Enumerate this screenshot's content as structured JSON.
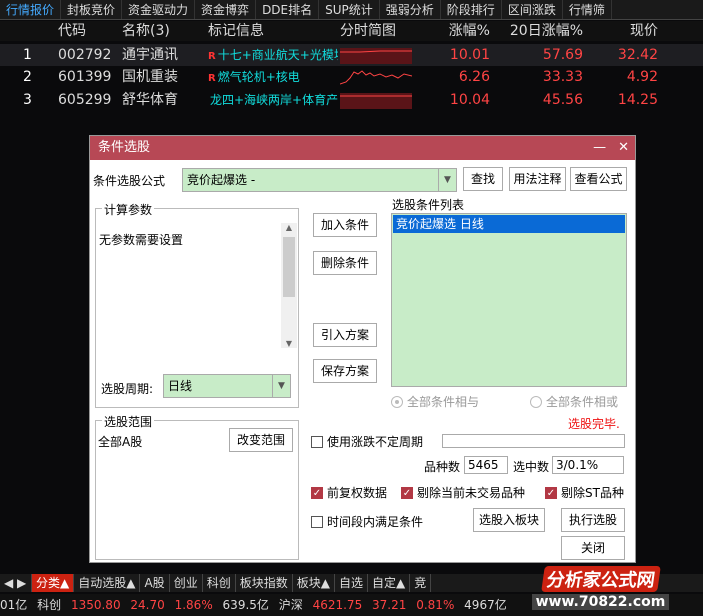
{
  "top_tabs": [
    "行情报价",
    "封板竞价",
    "资金驱动力",
    "资金博弈",
    "DDE排名",
    "SUP统计",
    "强弱分析",
    "阶段排行",
    "区间涨跌",
    "行情筛"
  ],
  "header": {
    "no": "",
    "code": "代码",
    "name": "名称(3)",
    "tag": "标记信息",
    "spark": "分时简图",
    "pct": "涨幅%",
    "pct20": "20日涨幅%",
    "price": "现价"
  },
  "rows": [
    {
      "no": "1",
      "code": "002792",
      "name": "通宇通讯",
      "tag_r": "R",
      "tag": "十七+商业航天+光模块",
      "pct": "10.01",
      "pct20": "57.69",
      "price": "32.42"
    },
    {
      "no": "2",
      "code": "601399",
      "name": "国机重装",
      "tag_r": "R",
      "tag": "燃气轮机+核电",
      "pct": "6.26",
      "pct20": "33.33",
      "price": "4.92"
    },
    {
      "no": "3",
      "code": "605299",
      "name": "舒华体育",
      "tag_r": "",
      "tag": "龙四+海峡两岸+体育产",
      "pct": "10.04",
      "pct20": "45.56",
      "price": "14.25"
    }
  ],
  "dialog": {
    "title": "条件选股",
    "formula_label": "条件选股公式",
    "formula_value": "竞价起爆选  -",
    "btn_find": "查找",
    "btn_usage": "用法注释",
    "btn_view": "查看公式",
    "calc_params_title": "计算参数",
    "calc_params_text": "无参数需要设置",
    "btn_add": "加入条件",
    "btn_delete": "删除条件",
    "btn_import": "引入方案",
    "btn_save": "保存方案",
    "cond_list_title": "选股条件列表",
    "cond_items": [
      "竞价起爆选  日线"
    ],
    "period_label": "选股周期:",
    "period_value": "日线",
    "radio_and": "全部条件相与",
    "radio_or": "全部条件相或",
    "status": "选股完毕.",
    "range_title": "选股范围",
    "range_value": "全部A股",
    "btn_change_range": "改变范围",
    "chk_uncertain": "使用涨跌不定周期",
    "count_label": "品种数",
    "count_value": "5465",
    "hit_label": "选中数",
    "hit_value": "3/0.1%",
    "chk_prior": "前复权数据",
    "chk_exclude_untraded": "剔除当前未交易品种",
    "chk_exclude_st": "剔除ST品种",
    "chk_period_satisfy": "时间段内满足条件",
    "btn_to_block": "选股入板块",
    "btn_execute": "执行选股",
    "btn_close": "关闭"
  },
  "bottom_tabs": [
    "分类▲",
    "自动选股▲",
    "A股",
    "创业",
    "科创",
    "板块指数",
    "板块▲",
    "自选",
    "自定▲",
    "竞"
  ],
  "status_bar": {
    "a": "01亿",
    "b": "科创",
    "c": "1350.80",
    "d": "24.70",
    "e": "1.86%",
    "f": "639.5亿",
    "g": "沪深",
    "h": "4621.75",
    "i": "37.21",
    "j": "0.81%",
    "k": "4967亿"
  },
  "logo": {
    "text": "分析家公式网",
    "url": "www.70822.com"
  },
  "colors": {
    "title_bar": "#b74855",
    "selected": "#0a6ad6",
    "green_bg": "#c8ecc8",
    "up": "#ff4444"
  }
}
